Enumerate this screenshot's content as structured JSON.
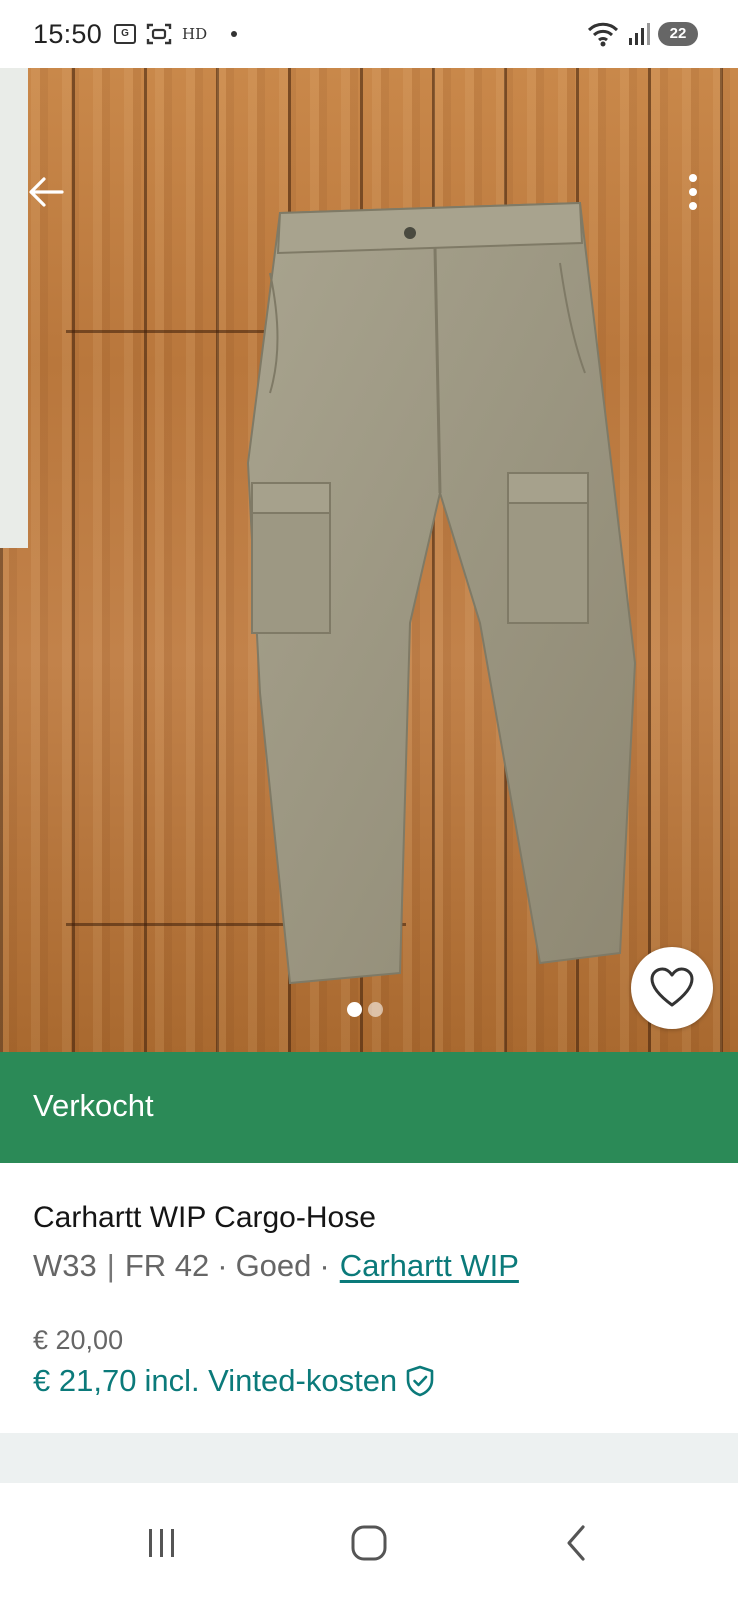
{
  "status_bar": {
    "time": "15:50",
    "hd_label": "HD",
    "battery": "22",
    "icons": [
      "gallery-icon",
      "screenshot-icon",
      "wifi-icon",
      "signal-icon",
      "battery-icon"
    ]
  },
  "hero": {
    "image_description": "photo-carousel",
    "page_count": 2,
    "active_page": 1,
    "back_icon": "arrow-left-icon",
    "more_icon": "more-vertical-icon",
    "favorite_icon": "heart-icon"
  },
  "banner": {
    "label": "Verkocht",
    "color": "#2b8a57"
  },
  "item": {
    "title": "Carhartt WIP Cargo-Hose",
    "size": "W33",
    "size_fr": "FR 42",
    "condition_sep": "·",
    "condition": "Goed",
    "brand": "Carhartt WIP",
    "price": "€ 20,00",
    "price_incl": "€ 21,70",
    "price_incl_note": "incl. Vinted-kosten",
    "accent_color": "#0b7a7a"
  },
  "navbar": {
    "icons": [
      "recent-apps-icon",
      "home-icon",
      "back-icon"
    ]
  }
}
